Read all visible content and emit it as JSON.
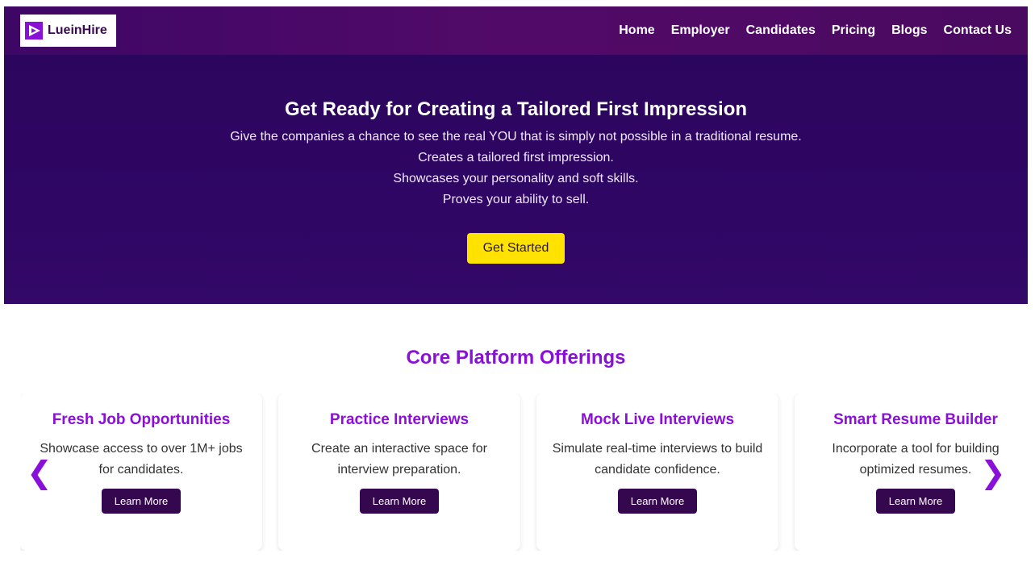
{
  "navbar": {
    "logo_text": "LueinHire",
    "links": [
      "Home",
      "Employer",
      "Candidates",
      "Pricing",
      "Blogs",
      "Contact Us"
    ]
  },
  "hero": {
    "title": "Get Ready for Creating a Tailored First Impression",
    "lines": [
      "Give the companies a chance to see the real YOU that is simply not possible in a traditional resume.",
      "Creates a tailored first impression.",
      "Showcases your personality and soft skills.",
      "Proves your ability to sell."
    ],
    "cta_label": "Get Started"
  },
  "offerings": {
    "title": "Core Platform Offerings",
    "cards": [
      {
        "title": "Fresh Job Opportunities",
        "desc": "Showcase access to over 1M+ jobs for candidates.",
        "button": "Learn More"
      },
      {
        "title": "Practice Interviews",
        "desc": "Create an interactive space for interview preparation.",
        "button": "Learn More"
      },
      {
        "title": "Mock Live Interviews",
        "desc": "Simulate real-time interviews to build candidate confidence.",
        "button": "Learn More"
      },
      {
        "title": "Smart Resume Builder",
        "desc": "Incorporate a tool for building optimized resumes.",
        "button": "Learn More"
      }
    ],
    "prev_arrow": "❮",
    "next_arrow": "❯"
  },
  "colors": {
    "brand_purple": "#8a10d8",
    "nav_bg": "#520a68",
    "hero_bg": "#2f0664",
    "cta_yellow": "#ffe200",
    "card_button": "#35074f"
  },
  "icons": {
    "logo": "play-triangle-icon",
    "prev": "chevron-left-icon",
    "next": "chevron-right-icon"
  }
}
